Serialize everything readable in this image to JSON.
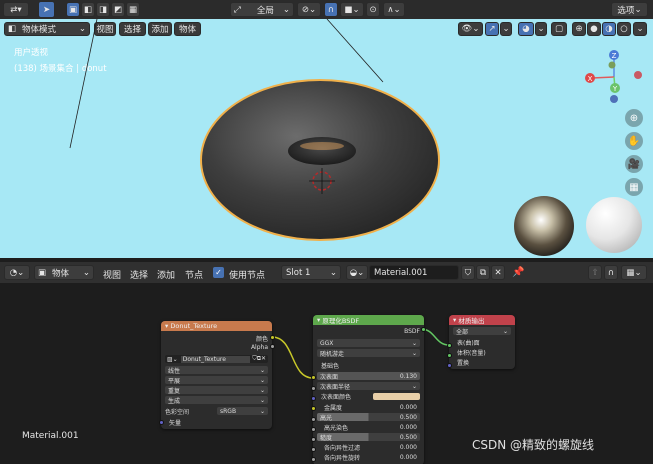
{
  "top_header": {
    "transform_global_label": "全局",
    "options_label": "选项"
  },
  "viewport_header": {
    "mode_label": "物体模式",
    "menus": [
      "视图",
      "选择",
      "添加",
      "物体"
    ]
  },
  "viewport": {
    "view_name": "用户透视",
    "collection_info": "(138) 场景集合 | donut",
    "gizmo_axes": [
      "X",
      "Y",
      "Z"
    ]
  },
  "node_header": {
    "type_label": "物体",
    "menus": [
      "视图",
      "选择",
      "添加",
      "节点"
    ],
    "use_nodes_label": "使用节点",
    "use_nodes_checked": true,
    "slot_label": "Slot 1",
    "material_name": "Material.001"
  },
  "node_editor": {
    "material_label": "Material.001",
    "watermark": "CSDN @精致的螺旋线"
  },
  "texture_node": {
    "title": "Donut_Texture",
    "outputs": [
      "颜色",
      "Alpha"
    ],
    "image_name": "Donut_Texture",
    "interpolation": "线性",
    "projection": "平展",
    "extension": "重复",
    "source": "生成",
    "color_space_label": "色彩空间",
    "color_space_value": "sRGB",
    "vector_label": "矢量"
  },
  "bsdf_node": {
    "title": "原理化BSDF",
    "output": "BSDF",
    "distribution": "GGX",
    "subsurface_method": "随机游走",
    "base_color_label": "基础色",
    "subsurface_label": "次表面",
    "subsurface_value": "0.130",
    "subsurface_radius_label": "次表面半径",
    "subsurface_color_label": "次表面颜色",
    "metallic_label": "金属度",
    "metallic_value": "0.000",
    "specular_label": "高光",
    "specular_value": "0.500",
    "specular_tint_label": "高光染色",
    "specular_tint_value": "0.000",
    "roughness_label": "糙度",
    "roughness_value": "0.500",
    "anisotropic_label": "各向异性过滤",
    "anisotropic_value": "0.000",
    "anisotropic_rotation_label": "各向异性旋转",
    "anisotropic_rotation_value": "0.000"
  },
  "output_node": {
    "title": "材质输出",
    "target": "全部",
    "inputs": [
      "表(曲)面",
      "体积(音量)",
      "置换"
    ]
  },
  "colors": {
    "viewport_bg": "#a7e8f5",
    "texture_header": "#c87a4d",
    "bsdf_header": "#5ea84c",
    "output_header": "#c1424b",
    "socket_yellow": "#c7c729",
    "socket_purple": "#6363c7",
    "socket_grey": "#a1a1a1",
    "socket_green": "#63c763"
  }
}
